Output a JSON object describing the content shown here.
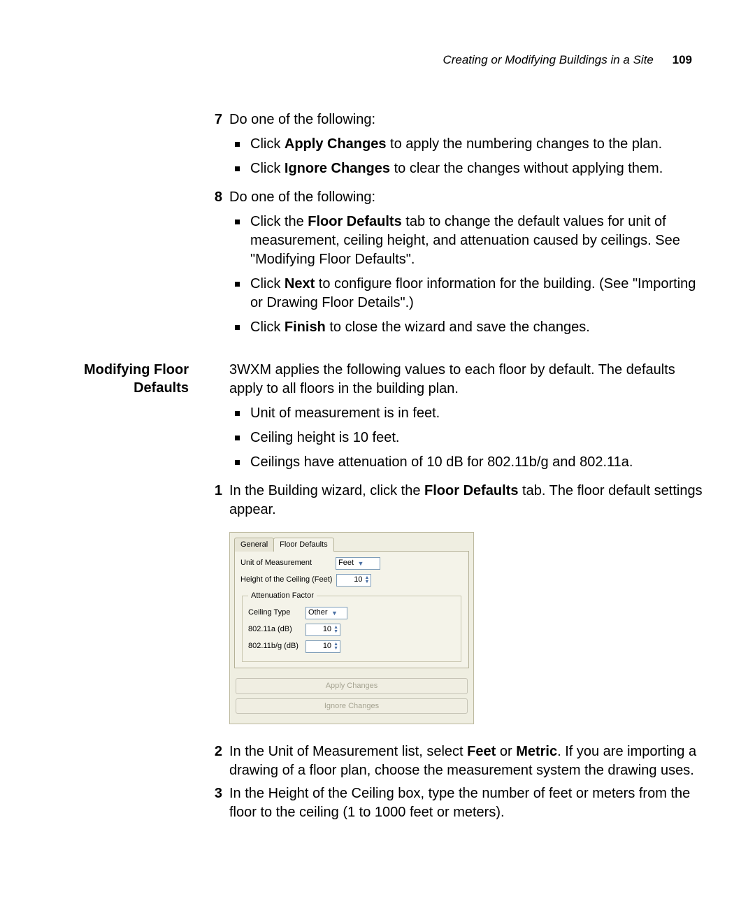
{
  "header": {
    "running_title": "Creating or Modifying Buildings in a Site",
    "page_number": "109"
  },
  "step7": {
    "num": "7",
    "text": "Do one of the following:",
    "b1_a": "Click ",
    "b1_bold": "Apply Changes",
    "b1_b": " to apply the numbering changes to the plan.",
    "b2_a": "Click ",
    "b2_bold": "Ignore Changes",
    "b2_b": " to clear the changes without applying them."
  },
  "step8": {
    "num": "8",
    "text": "Do one of the following:",
    "b1_a": "Click the ",
    "b1_bold": "Floor Defaults",
    "b1_b": " tab to change the default values for unit of measurement, ceiling height, and attenuation caused by ceilings. See \"Modifying Floor Defaults\".",
    "b2_a": "Click ",
    "b2_bold": "Next",
    "b2_b": " to configure floor information for the building. (See \"Importing or Drawing Floor Details\".)",
    "b3_a": "Click ",
    "b3_bold": "Finish",
    "b3_b": " to close the wizard and save the changes."
  },
  "section_heading": {
    "l1": "Modifying Floor",
    "l2": "Defaults"
  },
  "section_intro": "3WXM applies the following values to each floor by default. The defaults apply to all floors in the building plan.",
  "defaults_bullets": {
    "b1": "Unit of measurement is in feet.",
    "b2": "Ceiling height is 10 feet.",
    "b3": "Ceilings have attenuation of 10 dB for 802.11b/g and 802.11a."
  },
  "step1": {
    "num": "1",
    "a": "In the Building wizard, click the ",
    "bold": "Floor Defaults",
    "b": " tab. The floor default settings appear."
  },
  "dialog": {
    "tab_general": "General",
    "tab_floor_defaults": "Floor Defaults",
    "unit_label": "Unit of Measurement",
    "unit_value": "Feet",
    "height_label": "Height of the Ceiling (Feet)",
    "height_value": "10",
    "group_title": "Attenuation Factor",
    "ceiling_type_label": "Ceiling Type",
    "ceiling_type_value": "Other",
    "attn_a_label": "802.11a (dB)",
    "attn_a_value": "10",
    "attn_bg_label": "802.11b/g (dB)",
    "attn_bg_value": "10",
    "apply_btn": "Apply Changes",
    "ignore_btn": "Ignore Changes"
  },
  "step2": {
    "num": "2",
    "a": "In the Unit of Measurement list, select ",
    "bold1": "Feet",
    "mid": " or ",
    "bold2": "Metric",
    "b": ". If you are importing a drawing of a floor plan, choose the measurement system the drawing uses."
  },
  "step3": {
    "num": "3",
    "text": "In the Height of the Ceiling box, type the number of feet or meters from the floor to the ceiling (1 to 1000 feet or meters)."
  }
}
